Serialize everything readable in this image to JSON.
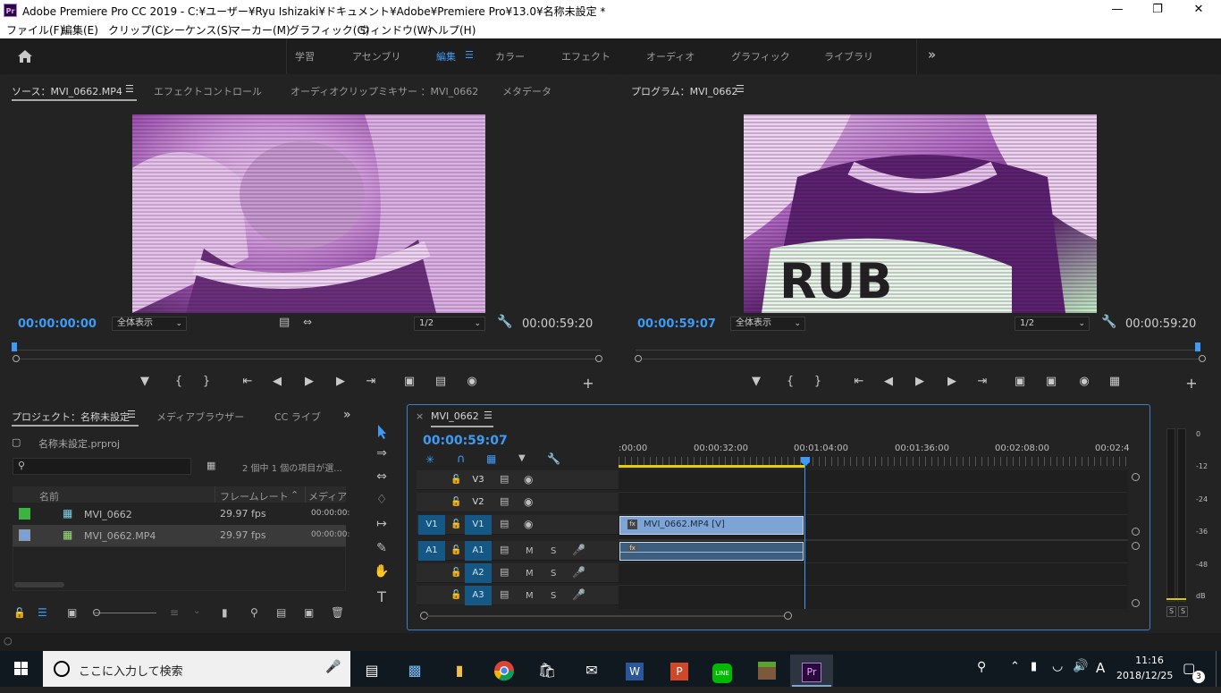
{
  "window": {
    "app_icon": "Pr",
    "title": "Adobe Premiere Pro CC 2019 - C:¥ユーザー¥Ryu Ishizaki¥ドキュメント¥Adobe¥Premiere Pro¥13.0¥名称未設定 *",
    "controls": [
      "minimize-icon",
      "maximize-icon",
      "close-icon"
    ]
  },
  "menu": [
    "ファイル(F)",
    "編集(E)",
    "クリップ(C)",
    "シーケンス(S)",
    "マーカー(M)",
    "グラフィック(G)",
    "ウィンドウ(W)",
    "ヘルプ(H)"
  ],
  "workspaces": {
    "items": [
      "学習",
      "アセンブリ",
      "編集",
      "カラー",
      "エフェクト",
      "オーディオ",
      "グラフィック",
      "ライブラリ"
    ],
    "active": "編集",
    "more": "»"
  },
  "source_panel": {
    "tabs": [
      "ソース：MVI_0662.MP4",
      "エフェクトコントロール",
      "オーディオクリップミキサー ：MVI_0662",
      "メタデータ"
    ],
    "timecode_in": "00:00:00:00",
    "zoom": "全体表示",
    "resolution": "1/2",
    "duration": "00:00:59:20"
  },
  "program_panel": {
    "tab": "プログラム：MVI_0662",
    "timecode": "00:00:59:07",
    "zoom": "全体表示",
    "resolution": "1/2",
    "duration": "00:00:59:20"
  },
  "project_panel": {
    "tabs": [
      "プロジェクト：名称未設定",
      "メディアブラウザー",
      "CC ライブ"
    ],
    "file": "名称未設定.prproj",
    "search_placeholder": "",
    "selection_info": "2 個中 1 個の項目が選...",
    "columns": [
      "名前",
      "フレームレート",
      "メディア"
    ],
    "rows": [
      {
        "name": "MVI_0662",
        "fps": "29.97 fps",
        "media": "00:00:00:",
        "color": "#3fb33f"
      },
      {
        "name": "MVI_0662.MP4",
        "fps": "29.97 fps",
        "media": "00:00:00:",
        "color": "#7b9fd9"
      }
    ]
  },
  "timeline": {
    "tab": "MVI_0662",
    "timecode": "00:00:59:07",
    "ruler": [
      ":00:00",
      "00:00:32:00",
      "00:01:04:00",
      "00:01:36:00",
      "00:02:08:00",
      "00:02:4"
    ],
    "video_tracks": [
      "V3",
      "V2",
      "V1"
    ],
    "audio_tracks": [
      "A1",
      "A2",
      "A3"
    ],
    "source_v": "V1",
    "source_a": "A1",
    "mute": "M",
    "solo": "S",
    "clip_video_label": "MVI_0662.MP4 [V]",
    "fx": "fx"
  },
  "audio_meter": {
    "scale": [
      "0",
      "-12",
      "-24",
      "-36",
      "-48",
      "dB"
    ],
    "solo_buttons": [
      "S",
      "S"
    ]
  },
  "taskbar": {
    "search_placeholder": "ここに入力して検索",
    "ime": "A",
    "time": "11:16",
    "date": "2018/12/25",
    "notifications": "3"
  },
  "colors": {
    "accent_blue": "#3d9bf5",
    "track_blue": "#155785",
    "clip_video": "#7ea4d6",
    "playhead": "#3d9bf5"
  }
}
